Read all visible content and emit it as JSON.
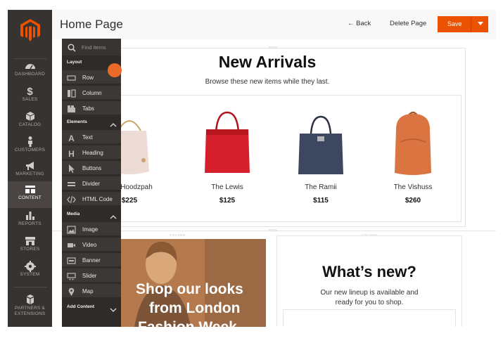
{
  "colors": {
    "accent": "#eb5202",
    "nav_bg": "#373330",
    "panel_bg": "#2e2b29"
  },
  "admin_nav": {
    "items": [
      {
        "label": "DASHBOARD",
        "icon": "dashboard-icon"
      },
      {
        "label": "SALES",
        "icon": "dollar-icon"
      },
      {
        "label": "CATALOG",
        "icon": "box-icon"
      },
      {
        "label": "CUSTOMERS",
        "icon": "person-icon"
      },
      {
        "label": "MARKETING",
        "icon": "megaphone-icon"
      },
      {
        "label": "CONTENT",
        "icon": "layout-icon",
        "active": true
      },
      {
        "label": "REPORTS",
        "icon": "bar-chart-icon"
      },
      {
        "label": "STORES",
        "icon": "store-icon"
      },
      {
        "label": "SYSTEM",
        "icon": "gear-icon"
      },
      {
        "label": "PARTNERS &",
        "label2": "EXTENSIONS",
        "icon": "blocks-icon"
      }
    ]
  },
  "header": {
    "title": "Home Page",
    "back_label": "← Back",
    "delete_label": "Delete Page",
    "save_label": "Save"
  },
  "panel": {
    "search_placeholder": "Find items",
    "sections": [
      {
        "label": "Layout",
        "items": [
          "Row",
          "Column",
          "Tabs"
        ]
      },
      {
        "label": "Elements",
        "items": [
          "Text",
          "Heading",
          "Buttons",
          "Divider",
          "HTML Code"
        ]
      },
      {
        "label": "Media",
        "items": [
          "Image",
          "Video",
          "Banner",
          "Slider",
          "Map"
        ]
      }
    ],
    "add_content_label": "Add Content"
  },
  "stage": {
    "row_label": "ROW",
    "column_label": "COLUMN",
    "heading": "New Arrivals",
    "subheading": "Browse these new items while they last.",
    "products": [
      {
        "name": "The Hoodzpah",
        "price": "$225",
        "color": "#e9d6cf"
      },
      {
        "name": "The Lewis",
        "price": "$125",
        "color": "#d01e2a"
      },
      {
        "name": "The Ramii",
        "price": "$115",
        "color": "#3c4459"
      },
      {
        "name": "The Vishuss",
        "price": "$260",
        "color": "#d9733c"
      }
    ],
    "promo_lines": [
      "Shop our looks",
      "from London",
      "Fashion Week"
    ],
    "whats_new_heading": "What’s new?",
    "whats_new_text_1": "Our new lineup is available and",
    "whats_new_text_2": "ready for you to shop."
  }
}
